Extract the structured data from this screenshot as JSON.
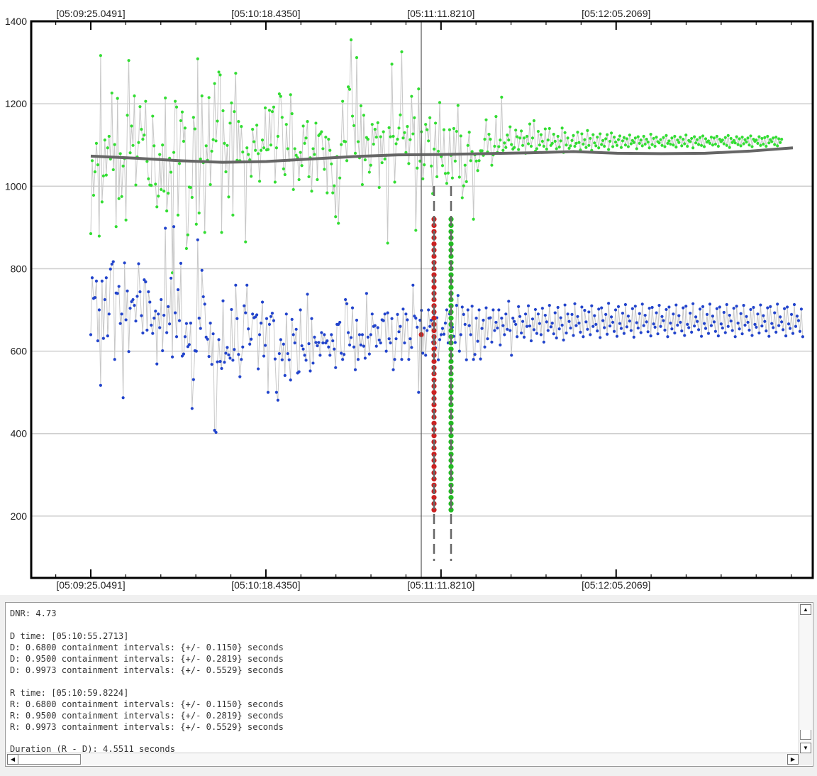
{
  "chart_data": {
    "type": "scatter",
    "title": "",
    "xlabel": "",
    "ylabel": "",
    "ylim": [
      50,
      1400
    ],
    "y_ticks": [
      200,
      400,
      600,
      800,
      1000,
      1200,
      1400
    ],
    "y_tick_labels": [
      "200",
      "400",
      "600",
      "800",
      "1000",
      "1200",
      "1400"
    ],
    "x_tick_labels": [
      "[05:09:25.0491]",
      "[05:10:18.4350]",
      "[05:11:11.8210]",
      "[05:12:05.2069]"
    ],
    "grid": true,
    "n_points": 500,
    "point_x_start": 0,
    "point_x_step": 1,
    "x_ticks": [
      0,
      124.45,
      248.91,
      373.36
    ],
    "series": [
      {
        "name": "",
        "color": "#33dd33",
        "values": [
          885,
          1062,
          978,
          1035,
          1104,
          1052,
          879,
          1317,
          962,
          1025,
          1112,
          1027,
          1093,
          1121,
          1066,
          1226,
          1040,
          1101,
          902,
          1213,
          970,
          1079,
          975,
          1049,
          1067,
          918,
          1172,
          1305,
          1081,
          1146,
          1099,
          1219,
          1003,
          1071,
          1106,
          1193,
          1138,
          1114,
          1124,
          1206,
          1060,
          1018,
          1003,
          1002,
          1170,
          1098,
          1005,
          950,
          976,
          1077,
          992,
          1100,
          988,
          1214,
          940,
          983,
          1068,
          1034,
          790,
          1082,
          1206,
          1192,
          930,
          1055,
          1159,
          1180,
          1109,
          1141,
          849,
          882,
          998,
          997,
          973,
          1167,
          1139,
          908,
          1309,
          935,
          1066,
          1219,
          1057,
          888,
          1098,
          1063,
          1215,
          1004,
          1085,
          1113,
          1249,
          1110,
          1158,
          1277,
          1270,
          888,
          1183,
          1104,
          1035,
          1099,
          974,
          1153,
          1202,
          930,
          1181,
          1274,
          1063,
          1157,
          1062,
          1145,
          1083,
          1059,
          865,
          1093,
          1077,
          1064,
          1024,
          1138,
          1108,
          1087,
          1148,
          1079,
          1012,
          1087,
          1112,
          1093,
          1190,
          1088,
          1089,
          1184,
          1100,
          1181,
          1192,
          1010,
          1093,
          1121,
          1224,
          1218,
          1167,
          1042,
          1028,
          1150,
          1091,
          1063,
          1222,
          1176,
          992,
          1091,
          1075,
          1069,
          1016,
          1082,
          1050,
          1146,
          1104,
          1117,
          1157,
          1023,
          1069,
          988,
          1091,
          1077,
          1153,
          1016,
          1123,
          1127,
          1132,
          1091,
          1041,
          1119,
          984,
          1114,
          1087,
          1054,
          984,
          1001,
          926,
          1072,
          910,
          1020,
          1101,
          1206,
          1109,
          1108,
          1062,
          1241,
          1235,
          1355,
          1170,
          1147,
          1080,
          1312,
          1108,
          1069,
          1195,
          1004,
          1172,
          1064,
          1118,
          1114,
          1034,
          1051,
          1150,
          1102,
          1138,
          1119,
          1154,
          997,
          1120,
          1057,
          1132,
          1066,
          1075,
          862,
          1142,
          1120,
          1296,
          1121,
          1010,
          1103,
          1114,
          1141,
          1173,
          1326,
          1117,
          1130,
          1082,
          1145,
          1055,
          1113,
          1218,
          1127,
          1166,
          893,
          1044,
          1236,
          1061,
          1132,
          1018,
          1052,
          1150,
          1137,
          1110,
          1166,
          1049,
          982,
          1090,
          1153,
          1023,
          1085,
          1203,
          1072,
          1050,
          1137,
          1031,
          1007,
          1032,
          1137,
          1075,
          1020,
          1140,
          1061,
          1133,
          1196,
          1022,
          1122,
          972,
          1001,
          1051,
          1011,
          1099,
          1131,
          1062,
          1084,
          920,
          1076,
          1061,
          1038,
          1062,
          1086,
          1086,
          1075,
          1114,
          1161,
          1083,
          1126,
          1114,
          1051,
          1076,
          1097,
          1169,
          1082,
          1096,
          1112,
          1216,
          1087,
          1105,
          1094,
          1124,
          1112,
          1144,
          1101,
          1090,
          1094,
          1136,
          1120,
          1089,
          1117,
          1134,
          1099,
          1117,
          1080,
          1121,
          1103,
          1151,
          1097,
          1117,
          1159,
          1085,
          1091,
          1133,
          1100,
          1125,
          1109,
          1097,
          1139,
          1090,
          1112,
          1140,
          1099,
          1104,
          1126,
          1109,
          1091,
          1121,
          1095,
          1110,
          1141,
          1082,
          1130,
          1100,
          1117,
          1092,
          1098,
          1111,
          1123,
          1097,
          1104,
          1131,
          1106,
          1088,
          1127,
          1102,
          1113,
          1094,
          1135,
          1099,
          1116,
          1087,
          1125,
          1105,
          1098,
          1119,
          1093,
          1127,
          1101,
          1111,
          1097,
          1115,
          1125,
          1089,
          1109,
          1129,
          1096,
          1119,
          1107,
          1099,
          1113,
          1122,
          1094,
          1110,
          1118,
          1100,
          1115,
          1096,
          1124,
          1103,
          1111,
          1106,
          1117,
          1091,
          1120,
          1104,
          1112,
          1098,
          1121,
          1102,
          1114,
          1107,
          1093,
          1126,
          1101,
          1116,
          1097,
          1119,
          1108,
          1105,
          1113,
          1099,
          1118,
          1096,
          1123,
          1104,
          1110,
          1102,
          1117,
          1100,
          1121,
          1095,
          1112,
          1106,
          1119,
          1098,
          1114,
          1103,
          1124,
          1097,
          1111,
          1108,
          1116,
          1093,
          1120,
          1105,
          1113,
          1101,
          1118,
          1099,
          1122,
          1096,
          1115,
          1107,
          1110,
          1104,
          1119,
          1100,
          1117,
          1102,
          1121,
          1097,
          1114,
          1108,
          1112,
          1103,
          1118,
          1099,
          1123,
          1094,
          1116,
          1106,
          1111,
          1105,
          1120,
          1101,
          1115,
          1098,
          1119,
          1103,
          1113,
          1107,
          1117,
          1100,
          1122,
          1096,
          1114,
          1109,
          1112,
          1104,
          1120,
          1099,
          1116,
          1102,
          1118,
          1097,
          1121,
          1105,
          1113,
          1108,
          1117,
          1101,
          1119,
          1098,
          1115,
          1106,
          1114
        ],
        "x": "points-index"
      },
      {
        "name": "",
        "color": "#2244cc",
        "values": [
          640,
          778,
          728,
          730,
          770,
          625,
          700,
          517,
          770,
          631,
          725,
          778,
          637,
          690,
          799,
          811,
          817,
          580,
          741,
          740,
          757,
          667,
          690,
          487,
          814,
          676,
          746,
          599,
          704,
          720,
          725,
          711,
          673,
          733,
          812,
          744,
          686,
          644,
          773,
          768,
          651,
          744,
          719,
          663,
          643,
          680,
          697,
          569,
          690,
          657,
          725,
          601,
          687,
          898,
          645,
          708,
          666,
          777,
          586,
          902,
          693,
          635,
          749,
          674,
          813,
          588,
          593,
          635,
          667,
          611,
          616,
          668,
          461,
          531,
          601,
          600,
          870,
          680,
          655,
          796,
          732,
          714,
          634,
          629,
          587,
          668,
          568,
          642,
          408,
          403,
          574,
          628,
          575,
          558,
          722,
          573,
          595,
          609,
          591,
          583,
          701,
          578,
          604,
          760,
          679,
          592,
          538,
          580,
          610,
          710,
          693,
          760,
          654,
          617,
          629,
          690,
          681,
          683,
          688,
          557,
          640,
          668,
          719,
          588,
          614,
          679,
          500,
          665,
          684,
          692,
          674,
          581,
          500,
          481,
          594,
          628,
          579,
          617,
          541,
          690,
          594,
          579,
          530,
          677,
          640,
          620,
          653,
          547,
          550,
          700,
          613,
          605,
          590,
          578,
          738,
          618,
          552,
          679,
          571,
          634,
          621,
          613,
          621,
          590,
          645,
          620,
          640,
          620,
          625,
          610,
          590,
          640,
          625,
          605,
          560,
          665,
          665,
          670,
          595,
          580,
          592,
          725,
          715,
          645,
          615,
          633,
          705,
          610,
          555,
          675,
          580,
          640,
          615,
          640,
          612,
          583,
          740,
          634,
          593,
          640,
          690,
          660,
          662,
          612,
          657,
          627,
          620,
          676,
          674,
          690,
          600,
          693,
          630,
          620,
          679,
          555,
          580,
          630,
          689,
          647,
          660,
          580,
          702,
          620,
          690,
          676,
          580,
          630,
          609,
          760,
          685,
          680,
          658,
          500,
          675,
          699,
          595,
          656,
          590,
          650,
          700,
          660,
          675,
          622,
          690,
          608,
          681,
          579,
          628,
          640,
          655,
          641,
          668,
          700,
          620,
          690,
          660,
          658,
          636,
          621,
          711,
          735,
          600,
          640,
          707,
          689,
          665,
          579,
          700,
          662,
          640,
          709,
          580,
          592,
          680,
          624,
          700,
          581,
          655,
          675,
          610,
          705,
          630,
          680,
          681,
          622,
          700,
          650,
          670,
          656,
          700,
          615,
          680,
          662,
          640,
          690,
          653,
          721,
          650,
          590,
          680,
          672,
          665,
          635,
          708,
          684,
          644,
          672,
          634,
          690,
          660,
          710,
          661,
          625,
          678,
          652,
          701,
          643,
          690,
          667,
          640,
          704,
          622,
          687,
          671,
          650,
          711,
          659,
          668,
          642,
          693,
          632,
          706,
          654,
          681,
          663,
          627,
          712,
          644,
          690,
          672,
          656,
          689,
          638,
          715,
          662,
          684,
          668,
          646,
          707,
          635,
          699,
          671,
          653,
          695,
          640,
          710,
          660,
          686,
          665,
          649,
          702,
          633,
          705,
          674,
          657,
          689,
          641,
          716,
          661,
          683,
          670,
          648,
          700,
          636,
          708,
          667,
          655,
          692,
          643,
          713,
          659,
          685,
          673,
          650,
          703,
          634,
          709,
          669,
          656,
          691,
          645,
          714,
          662,
          687,
          671,
          647,
          704,
          637,
          706,
          666,
          658,
          693,
          642,
          711,
          660,
          684,
          674,
          651,
          701,
          635,
          707,
          668,
          654,
          690,
          644,
          712,
          663,
          686,
          670,
          649,
          705,
          638,
          709,
          665,
          657,
          692,
          646,
          715,
          661,
          683,
          672,
          652,
          702,
          636,
          708,
          667,
          655,
          689,
          643,
          714,
          662,
          685,
          671,
          648,
          703,
          637,
          707,
          666,
          656,
          694,
          645,
          713,
          660,
          687,
          673,
          650,
          704,
          635,
          709,
          668,
          654,
          691,
          642,
          711,
          663,
          684,
          670,
          651,
          701,
          638,
          706,
          665,
          658,
          690,
          644,
          712,
          661,
          686,
          672,
          649,
          705,
          636,
          708,
          667,
          657,
          693,
          646,
          714,
          662,
          683,
          671,
          652,
          703,
          637,
          707,
          666,
          655,
          689,
          643,
          713,
          660,
          685,
          674,
          648,
          702,
          635
        ],
        "x": "points-index"
      },
      {
        "name": "",
        "color": "#cc2222",
        "values": [
          920,
          905,
          890,
          875,
          860,
          845,
          830,
          815,
          800,
          785,
          770,
          755,
          740,
          725,
          710,
          695,
          680,
          665,
          650,
          635,
          620,
          605,
          590,
          575,
          560,
          545,
          530,
          515,
          500,
          485,
          470,
          455,
          440,
          425,
          410,
          395,
          380,
          365,
          350,
          335,
          320,
          305,
          290,
          275,
          260,
          245,
          230,
          215
        ],
        "x": "column"
      },
      {
        "name": "",
        "color": "#22bb22",
        "values": [
          920,
          905,
          890,
          875,
          860,
          845,
          830,
          815,
          800,
          785,
          770,
          755,
          740,
          725,
          710,
          695,
          680,
          665,
          650,
          635,
          620,
          605,
          590,
          575,
          560,
          545,
          530,
          515,
          500,
          485,
          470,
          455,
          440,
          425,
          410,
          395,
          380,
          365,
          350,
          335,
          320,
          305,
          290,
          275,
          260,
          245,
          230,
          215
        ],
        "x": "column"
      }
    ],
    "trend_values": [
      1073,
      1068,
      1062,
      1058,
      1060,
      1066,
      1072,
      1076,
      1077,
      1079,
      1081,
      1084,
      1080,
      1079,
      1080,
      1085,
      1093
    ],
    "vertical_markers": {
      "cursor_color": "#555555",
      "d_color": "#666666",
      "r_color": "#666666"
    },
    "legend": "none"
  },
  "report": {
    "dnr": "DNR: 4.73",
    "d_time": "D time: [05:10:55.2713]",
    "d_lines": [
      "D: 0.6800 containment intervals: {+/- 0.1150} seconds",
      "D: 0.9500 containment intervals: {+/- 0.2819} seconds",
      "D: 0.9973 containment intervals: {+/- 0.5529} seconds"
    ],
    "r_time": "R time: [05:10:59.8224]",
    "r_lines": [
      "R: 0.6800 containment intervals: {+/- 0.1150} seconds",
      "R: 0.9500 containment intervals: {+/- 0.2819} seconds",
      "R: 0.9973 containment intervals: {+/- 0.5529} seconds"
    ],
    "duration": "Duration (R - D): 4.5511 seconds"
  },
  "icons": {
    "up": "arrow-up-icon",
    "down": "arrow-down-icon",
    "left": "arrow-left-icon",
    "right": "arrow-right-icon"
  }
}
